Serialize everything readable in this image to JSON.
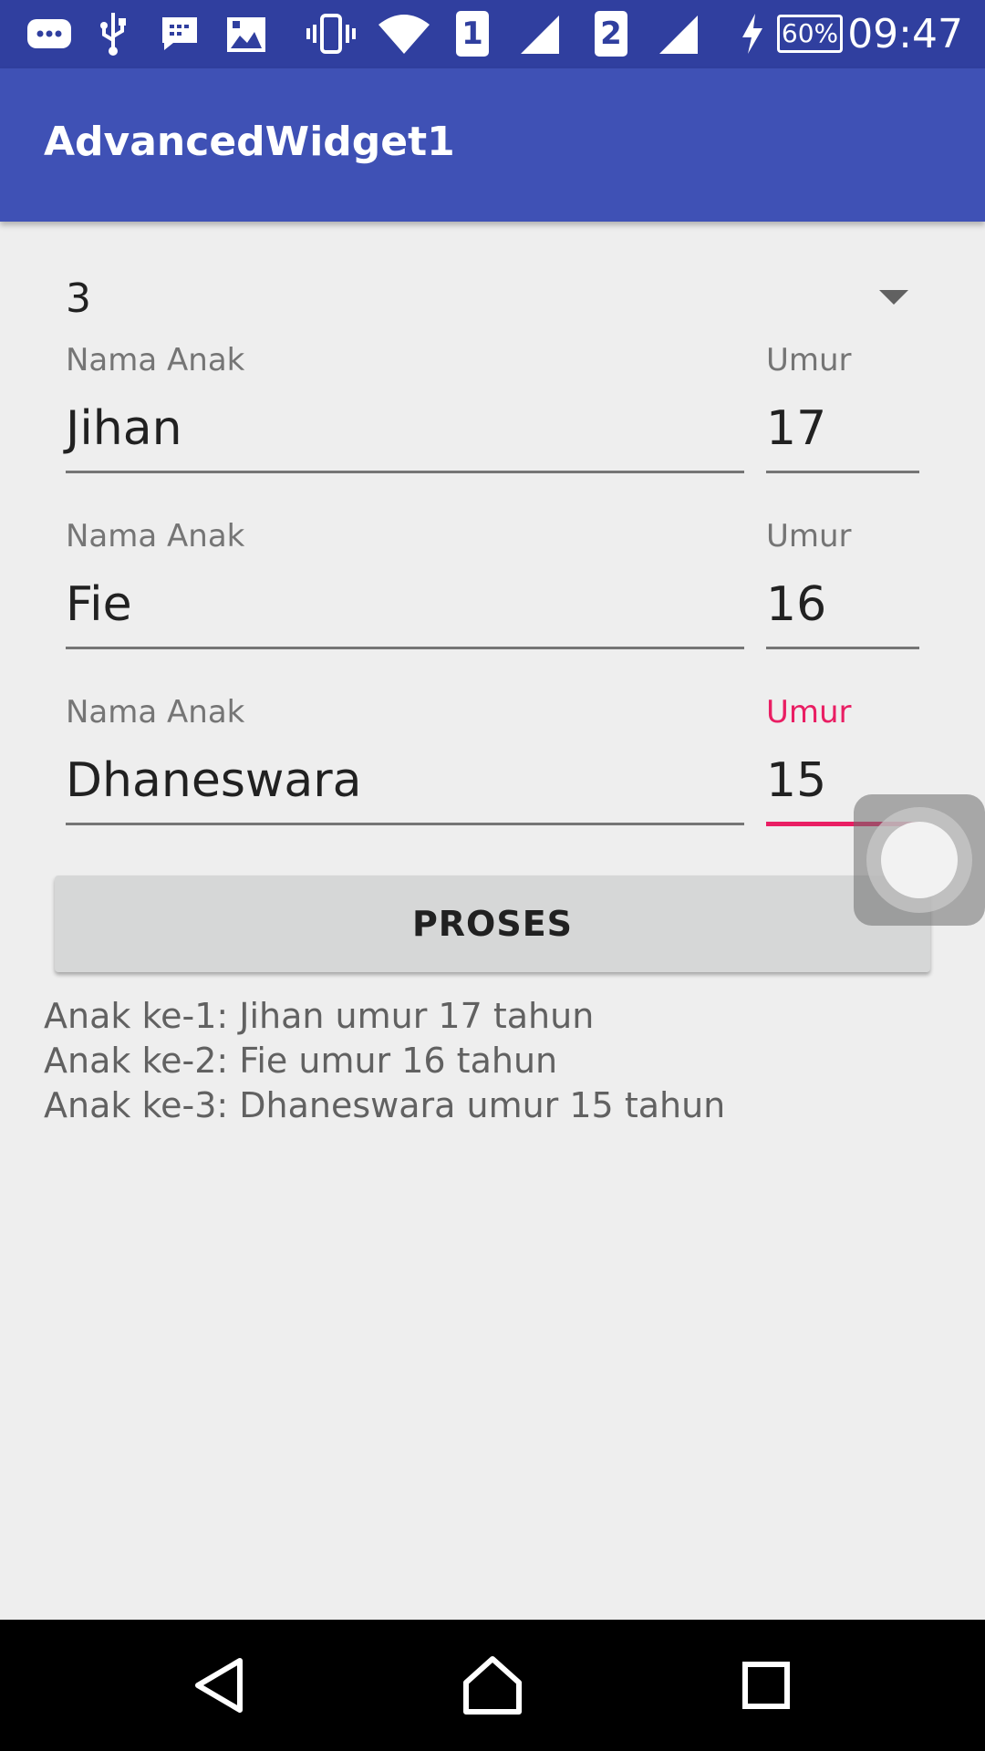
{
  "status_bar": {
    "time": "09:47",
    "battery": "60%",
    "sim1": "1",
    "sim2": "2",
    "icons": [
      "message-icon",
      "usb-icon",
      "bbm-icon",
      "gallery-icon",
      "vibrate-icon",
      "wifi-icon",
      "signal-icon",
      "signal-icon",
      "charging-icon",
      "battery-icon"
    ]
  },
  "toolbar": {
    "title": "AdvancedWidget1"
  },
  "spinner": {
    "selected": "3"
  },
  "children": [
    {
      "name_label": "Nama Anak",
      "name_value": "Jihan",
      "age_label": "Umur",
      "age_value": "17"
    },
    {
      "name_label": "Nama Anak",
      "name_value": "Fie",
      "age_label": "Umur",
      "age_value": "16"
    },
    {
      "name_label": "Nama Anak",
      "name_value": "Dhaneswara",
      "age_label": "Umur",
      "age_value": "15"
    }
  ],
  "button": {
    "label": "PROSES"
  },
  "result": [
    "Anak ke-1: Jihan umur 17 tahun",
    "Anak ke-2: Fie umur 16 tahun",
    "Anak ke-3: Dhaneswara umur 15 tahun"
  ],
  "colors": {
    "primary_dark": "#303f9f",
    "primary": "#3f51b5",
    "accent": "#e91e63"
  }
}
